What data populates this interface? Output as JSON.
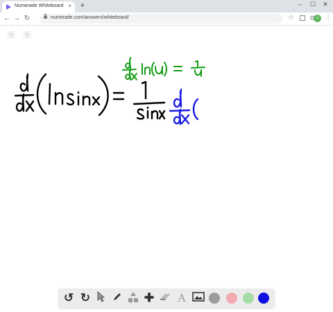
{
  "browser": {
    "tab_title": "Numerade Whiteboard",
    "tab_close": "×",
    "new_tab": "+",
    "url": "numerade.com/answers/whiteboard/",
    "avatar_letter": "J",
    "window_controls": [
      "–",
      "☐",
      "✕"
    ]
  },
  "board": {
    "nav_prev": "‹",
    "nav_next": "›",
    "main_lhs": "d/dx ( ln sin x )",
    "equals": "=",
    "rhs_fraction": "1 / sin x",
    "rhs_derivative": "d/dx (",
    "hint_rule": "d/dx ln(u) = 1/u",
    "ink_colors": {
      "black": "#000000",
      "green": "#129b12",
      "blue": "#1a1ae6"
    }
  },
  "toolbar": {
    "undo": "undo-icon",
    "redo": "redo-icon",
    "select": "cursor-icon",
    "pen": "pen-icon",
    "shapes": "shapes-icon",
    "add": "plus-icon",
    "eraser": "eraser-icon",
    "text_label": "A",
    "image": "image-icon",
    "colors": [
      "#9b9b9b",
      "#f0aab0",
      "#a6dca6",
      "#1010e0"
    ]
  }
}
